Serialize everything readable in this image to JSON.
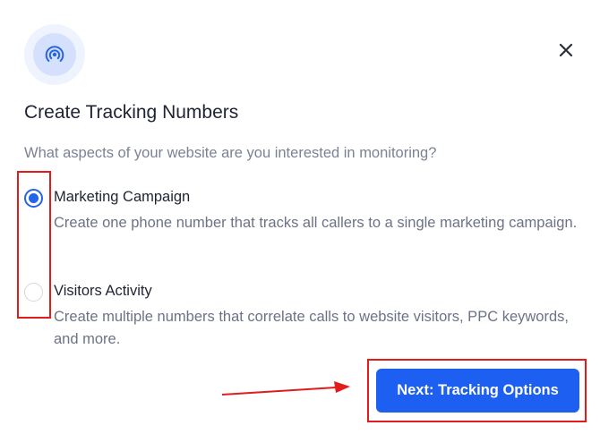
{
  "dialog": {
    "header_icon": "broadcast-signal-icon",
    "close_icon": "close-icon",
    "title": "Create Tracking Numbers",
    "subtitle": "What aspects of your website are you interested in monitoring?",
    "options": [
      {
        "label": "Marketing Campaign",
        "description": "Create one phone number that tracks all callers to a single marketing campaign.",
        "selected": true
      },
      {
        "label": "Visitors Activity",
        "description": "Create multiple numbers that correlate calls to website visitors, PPC keywords, and more.",
        "selected": false
      }
    ],
    "next_button_label": "Next: Tracking Options"
  },
  "colors": {
    "accent": "#2563eb",
    "button": "#1d5ff0",
    "annotation": "#e21b1b",
    "title": "#1f2333",
    "muted": "#7b8294"
  }
}
